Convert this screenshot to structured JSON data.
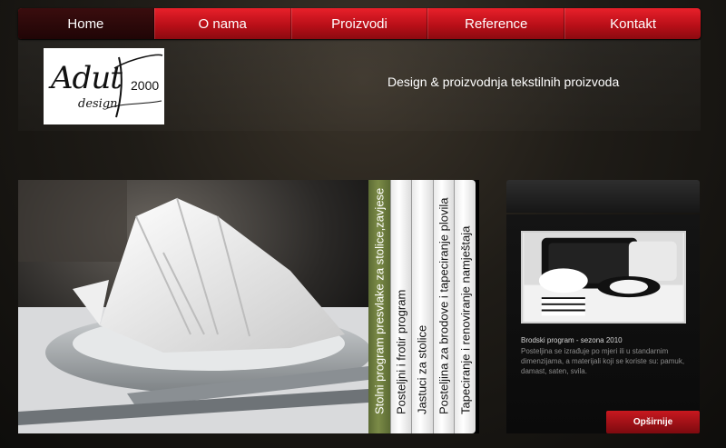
{
  "nav": {
    "items": [
      {
        "label": "Home",
        "active": true
      },
      {
        "label": "O nama"
      },
      {
        "label": "Proizvodi"
      },
      {
        "label": "Reference"
      },
      {
        "label": "Kontakt"
      }
    ]
  },
  "logo": {
    "main": "Adut",
    "sub": "design",
    "year": "2000"
  },
  "header": {
    "tagline": "Design & proizvodnja tekstilnih proizvoda"
  },
  "slider": {
    "tabs": [
      {
        "label": "Stolni program presvlake za stolice,zavjese",
        "active": true
      },
      {
        "label": "Posteljni i frotir program"
      },
      {
        "label": "Jastuci za stolice"
      },
      {
        "label": "Posteljina za brodove i tapeciranje plovila"
      },
      {
        "label": "Tapeciranje i renoviranje namještaja"
      }
    ]
  },
  "side": {
    "title": "Brodski program - sezona 2010",
    "text": "Posteljina se izrađuje po mjeri ili u standarnim dimenzijama, a materijali koji se koriste su: pamuk, damast, saten, svila.",
    "button": "Opširnije"
  },
  "colors": {
    "accent": "#c8121b",
    "active_tab": "#6e7d3e"
  }
}
